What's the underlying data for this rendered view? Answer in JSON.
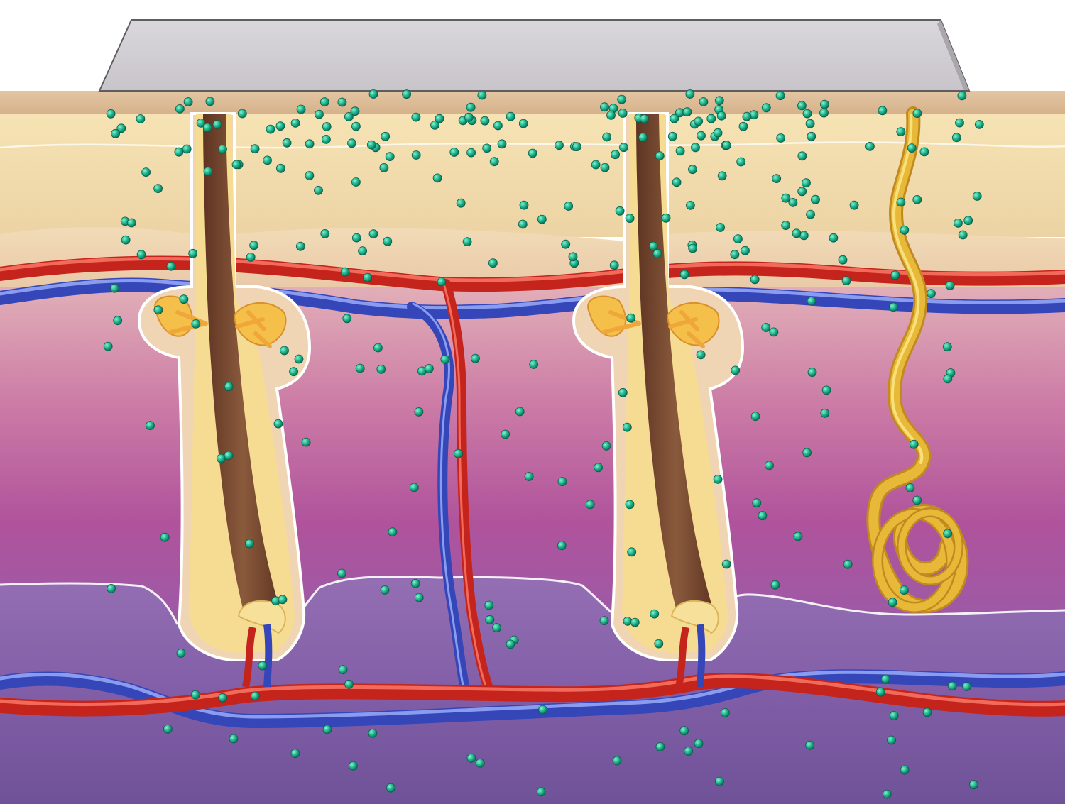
{
  "diagram": {
    "subject": "skin-cross-section-transdermal-patch",
    "labels": [],
    "colors": {
      "background": "#ffffff",
      "patch_top": "#d3d0d6",
      "patch_face": "#bfbcc2",
      "patch_edge": "#6f6c72",
      "stratum_corneum": "#dcb995",
      "epidermis_upper": "#f3dfae",
      "epidermis_lower": "#efd0b0",
      "dermis_upper": "#d99bb0",
      "dermis_mid": "#b45a9e",
      "dermis_lower": "#9866a8",
      "hypodermis": "#7a5aa0",
      "artery": "#c92a22",
      "artery_highlight": "#f06a5a",
      "vein": "#4a5bc6",
      "vein_highlight": "#8a9cf0",
      "hair_shaft": "#7a4a30",
      "follicle_sheath": "#f6dc92",
      "sebaceous_gland": "#f0a73a",
      "sweat_gland": "#e2b236",
      "drug_particle": "#1fb98f",
      "membrane_line": "#ffffff"
    }
  }
}
